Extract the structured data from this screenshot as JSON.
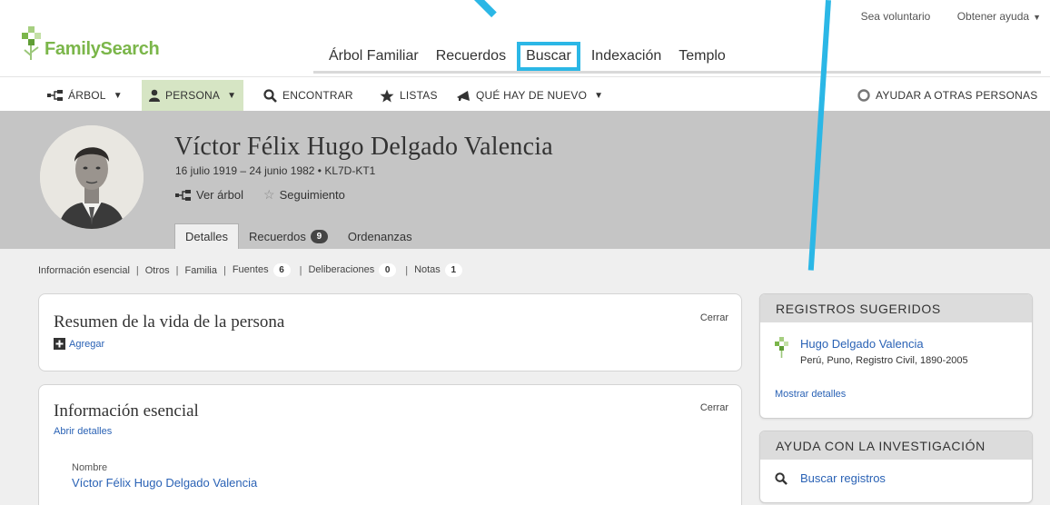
{
  "utility": {
    "volunteer": "Sea voluntario",
    "help": "Obtener ayuda"
  },
  "brand": {
    "name": "FamilySearch",
    "color": "#7bb64a"
  },
  "mainnav": {
    "items": [
      "Árbol Familiar",
      "Recuerdos",
      "Buscar",
      "Indexación",
      "Templo"
    ],
    "highlighted": "Buscar",
    "highlight_color": "#2bb7e6"
  },
  "subnav": {
    "tree": "ÁRBOL",
    "person": "PERSONA",
    "find": "ENCONTRAR",
    "lists": "LISTAS",
    "whats_new": "QUÉ HAY DE NUEVO",
    "help_others": "AYUDAR A OTRAS PERSONAS"
  },
  "person": {
    "name": "Víctor Félix Hugo Delgado Valencia",
    "dates_id": "16 julio 1919 – 24 junio 1982 • KL7D-KT1",
    "view_tree": "Ver árbol",
    "follow": "Seguimiento"
  },
  "tabs": [
    {
      "label": "Detalles",
      "count": null
    },
    {
      "label": "Recuerdos",
      "count": "9"
    },
    {
      "label": "Ordenanzas",
      "count": null
    }
  ],
  "sections": {
    "essential": "Información esencial",
    "others": "Otros",
    "family": "Familia",
    "sources": "Fuentes",
    "sources_count": "6",
    "discussions": "Deliberaciones",
    "discussions_count": "0",
    "notes": "Notas",
    "notes_count": "1"
  },
  "summary_card": {
    "title": "Resumen de la vida de la persona",
    "close": "Cerrar",
    "add": "Agregar"
  },
  "info_card": {
    "title": "Información esencial",
    "close": "Cerrar",
    "open_details": "Abrir detalles",
    "name_label": "Nombre",
    "name_value": "Víctor Félix Hugo Delgado Valencia"
  },
  "suggested": {
    "heading": "REGISTROS SUGERIDOS",
    "record_name": "Hugo Delgado Valencia",
    "record_source": "Perú, Puno, Registro Civil, 1890-2005",
    "show_details": "Mostrar detalles"
  },
  "research_help": {
    "heading": "AYUDA CON LA INVESTIGACIÓN",
    "search_records": "Buscar registros"
  }
}
